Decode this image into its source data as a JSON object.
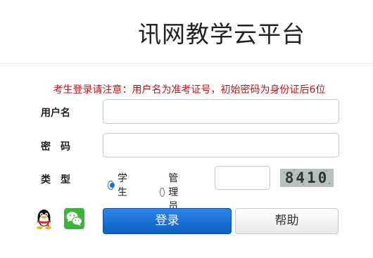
{
  "header": {
    "title": "讯网教学云平台"
  },
  "notice": "考生登录请注意：用户名为准考证号，初始密码为身份证后6位",
  "form": {
    "username_label": "用户名",
    "username_value": "",
    "password_label": "密　码",
    "password_value": "",
    "type_label": "类　型",
    "role_options": [
      {
        "label": "学生",
        "selected": true
      },
      {
        "label": "管理员",
        "selected": false
      }
    ],
    "captcha_value": "",
    "captcha_image_text": "8410"
  },
  "buttons": {
    "login": "登录",
    "help": "帮助"
  },
  "social": {
    "qq_icon": "qq-penguin-icon",
    "wechat_icon": "wechat-icon"
  },
  "colors": {
    "notice": "#c0161a",
    "primary": "#0d5fc4",
    "wechat": "#3ab53a"
  }
}
